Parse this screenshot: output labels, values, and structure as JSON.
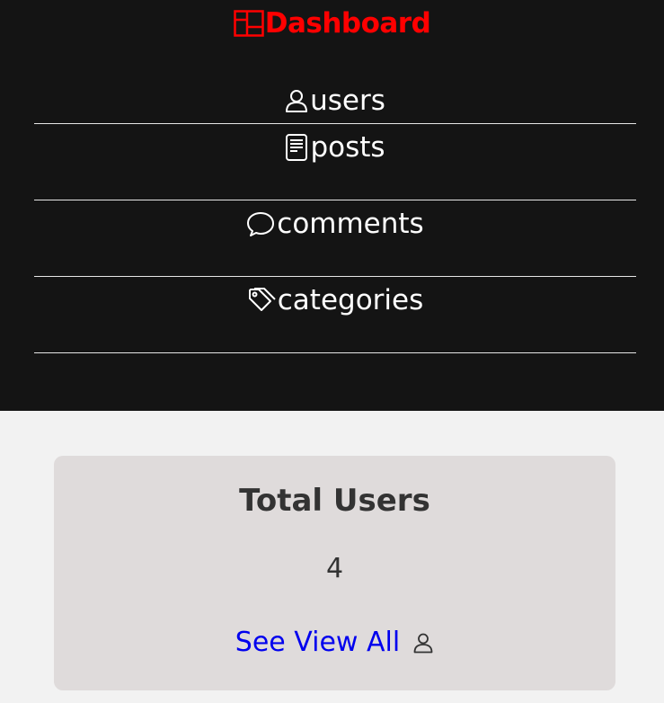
{
  "brand": {
    "title": "Dashboard",
    "icon": "dashboard-icon",
    "color": "#ff0000"
  },
  "sidebar": {
    "background": "#141414",
    "items": [
      {
        "label": "users",
        "icon": "user-icon"
      },
      {
        "label": "posts",
        "icon": "document-icon"
      },
      {
        "label": "comments",
        "icon": "comment-icon"
      },
      {
        "label": "categories",
        "icon": "tag-icon"
      }
    ]
  },
  "card": {
    "title": "Total Users",
    "count": "4",
    "link_label": "See View All",
    "link_icon": "user-icon",
    "link_color": "#0000ee"
  }
}
